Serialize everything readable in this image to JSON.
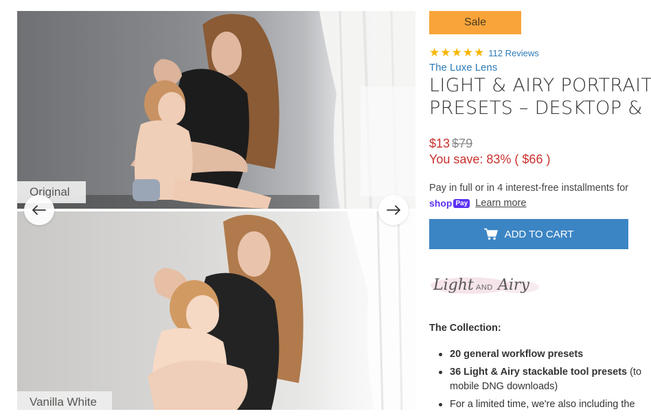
{
  "gallery": {
    "images": [
      {
        "label": "Original"
      },
      {
        "label": "Vanilla White"
      }
    ],
    "prev_icon": "arrow-left-icon",
    "next_icon": "arrow-right-icon"
  },
  "product": {
    "badge": "Sale",
    "rating": {
      "stars": 5,
      "max": 5,
      "reviews_text": "112 Reviews"
    },
    "vendor": "The Luxe Lens",
    "title_line1": "LIGHT & AIRY PORTRAIT",
    "title_line2": "PRESETS – DESKTOP &",
    "price": "$13",
    "compare_price": "$79",
    "savings": "You save: 83% ( $66 )",
    "installments": "Pay in full or in 4 interest-free installments for",
    "shoppay_word": "shop",
    "shoppay_pay": "Pay",
    "learn_more": "Learn more",
    "add_to_cart": "ADD TO CART",
    "brand_logo_text": "Light AND Airy",
    "collection_heading": "The Collection:",
    "features": [
      {
        "bold": "20 general workflow presets",
        "rest": ""
      },
      {
        "bold": "36 Light & Airy stackable tool presets",
        "rest": " (to",
        "cont": "mobile DNG downloads)"
      },
      {
        "bold": "",
        "rest": "For a limited time, we're also including the"
      }
    ]
  },
  "colors": {
    "sale_badge": "#f9a43a",
    "accent_blue": "#2b7ab5",
    "button_blue": "#3c85c4",
    "price_red": "#c9302c",
    "star": "#f7b500",
    "shoppay": "#5a31f4"
  }
}
